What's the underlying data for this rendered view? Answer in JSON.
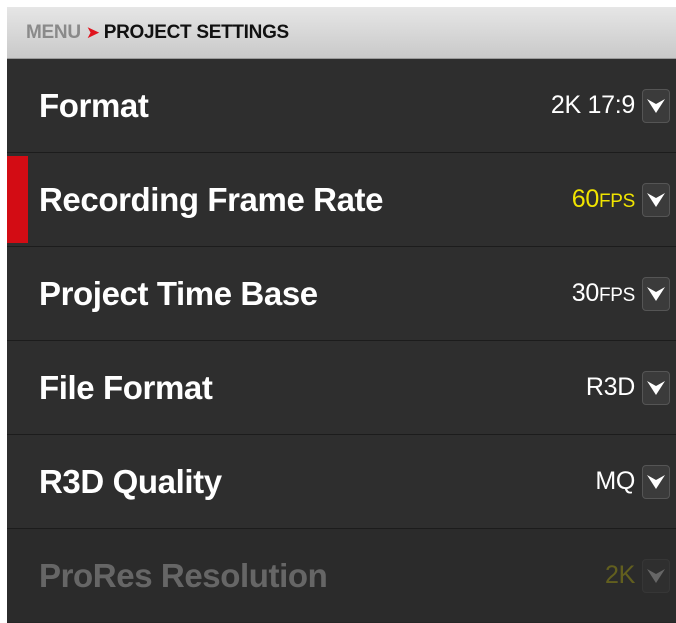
{
  "breadcrumb": {
    "menu": "MENU",
    "separator": "➤",
    "current": "PROJECT SETTINGS"
  },
  "rows": [
    {
      "label": "Format",
      "value": "2K 17:9",
      "unit": "",
      "selected": false,
      "disabled": false
    },
    {
      "label": "Recording Frame Rate",
      "value": "60",
      "unit": "FPS",
      "selected": true,
      "disabled": false
    },
    {
      "label": "Project Time Base",
      "value": "30",
      "unit": "FPS",
      "selected": false,
      "disabled": false
    },
    {
      "label": "File Format",
      "value": "R3D",
      "unit": "",
      "selected": false,
      "disabled": false
    },
    {
      "label": "R3D Quality",
      "value": "MQ",
      "unit": "",
      "selected": false,
      "disabled": false
    },
    {
      "label": "ProRes Resolution",
      "value": "2K",
      "unit": "",
      "selected": false,
      "disabled": true
    }
  ],
  "colors": {
    "accent": "#d30c14",
    "selected_value": "#f0e400",
    "background": "#2e2e2e"
  },
  "icons": {
    "dropdown": "chevron-down-icon"
  }
}
